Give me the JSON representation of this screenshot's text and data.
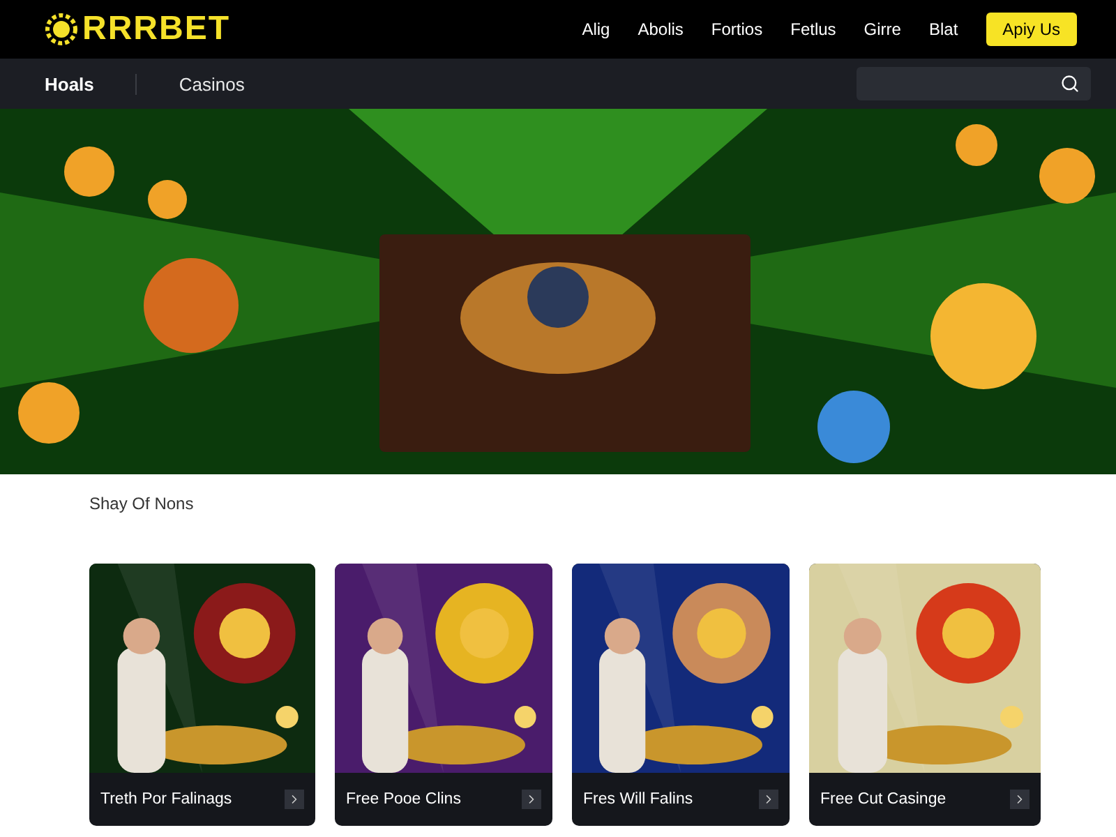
{
  "header": {
    "logo": "RRRBET",
    "nav": [
      "Alig",
      "Abolis",
      "Fortios",
      "Fetlus",
      "Girre",
      "Blat"
    ],
    "cta": "Apiy Us"
  },
  "subnav": {
    "tabs": [
      {
        "label": "Hoals",
        "selected": true
      },
      {
        "label": "Casinos",
        "selected": false
      }
    ]
  },
  "section": {
    "title": "Shay Of Nons",
    "cards": [
      {
        "title": "Treth Por Falinags",
        "kind": "picture"
      },
      {
        "title": "Free Pooe Clins",
        "kind": "picture"
      },
      {
        "title": "Fres Will Falins",
        "kind": "picture"
      },
      {
        "title": "Free Cut Casinge",
        "kind": "picture"
      }
    ]
  }
}
